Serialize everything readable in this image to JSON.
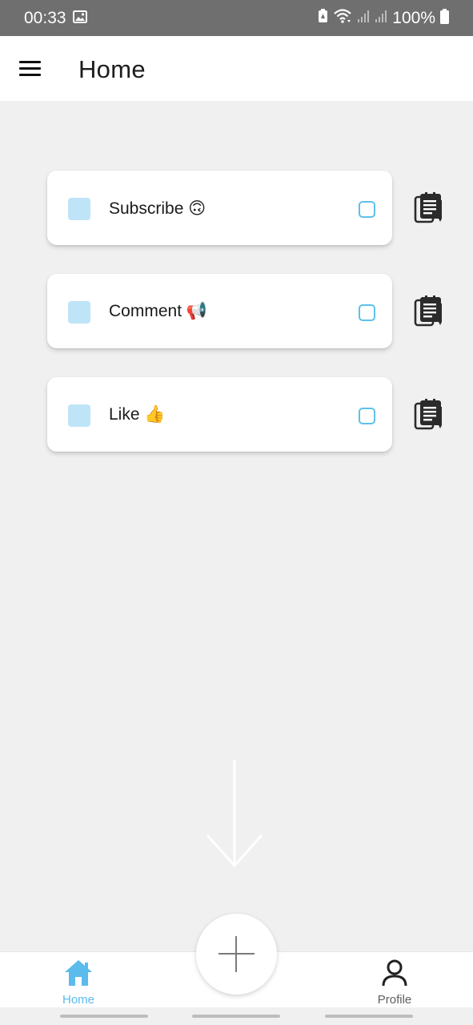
{
  "status_bar": {
    "time": "00:33",
    "battery": "100%",
    "icons": [
      "gallery-icon",
      "battery-saver-icon",
      "wifi-icon",
      "signal-icon",
      "signal-icon",
      "battery-icon"
    ]
  },
  "app_bar": {
    "title": "Home",
    "menu_icon": "hamburger-menu-icon"
  },
  "tasks": [
    {
      "label": "Subscribe 🙃",
      "color": "#bfe4f8",
      "checked": false
    },
    {
      "label": "Comment 📢",
      "color": "#bfe4f8",
      "checked": false
    },
    {
      "label": "Like 👍",
      "color": "#bfe4f8",
      "checked": false
    }
  ],
  "task_action_icon": "notes-clipboard-icon",
  "hint_icon": "arrow-down-icon",
  "fab_icon": "plus-icon",
  "bottom_nav": {
    "items": [
      {
        "label": "Home",
        "icon": "home-icon",
        "active": true
      },
      {
        "label": "Profile",
        "icon": "person-icon",
        "active": false
      }
    ]
  },
  "colors": {
    "accent": "#5bbbed",
    "task_swatch": "#bfe4f8",
    "background": "#f0f0f0",
    "status_bar": "#6f6f6f"
  }
}
